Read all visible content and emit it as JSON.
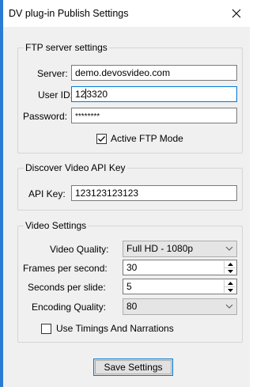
{
  "window": {
    "title": "DV plug-in Publish Settings",
    "close_icon": "close-icon"
  },
  "ftp": {
    "group_label": "FTP server settings",
    "server_label": "Server:",
    "server_value": "demo.devosvideo.com",
    "userid_label": "User ID:",
    "userid_value_before": "12",
    "userid_value_after": "3320",
    "password_label": "Password:",
    "password_value": "********",
    "active_ftp_label": "Active FTP Mode",
    "active_ftp_checked": true
  },
  "api": {
    "group_label": "Discover Video API Key",
    "apikey_label": "API Key:",
    "apikey_value": "123123123123"
  },
  "video": {
    "group_label": "Video Settings",
    "quality_label": "Video Quality:",
    "quality_value": "Full HD - 1080p",
    "fps_label": "Frames per second:",
    "fps_value": "30",
    "sps_label": "Seconds per slide:",
    "sps_value": "5",
    "encoding_label": "Encoding Quality:",
    "encoding_value": "80",
    "timings_label": "Use Timings And Narrations",
    "timings_checked": false
  },
  "actions": {
    "save_label": "Save Settings"
  },
  "colors": {
    "accent": "#0078d7",
    "window_edge": "#2b7bd3",
    "client_bg": "#f0f0f0"
  }
}
